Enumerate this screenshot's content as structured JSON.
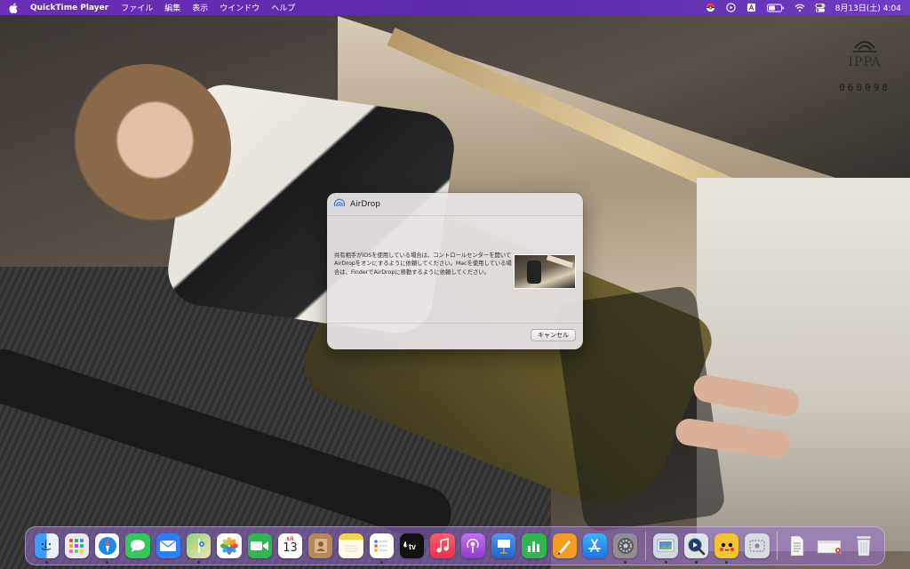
{
  "menubar": {
    "app_name": "QuickTime Player",
    "items": [
      "ファイル",
      "編集",
      "表示",
      "ウインドウ",
      "ヘルプ"
    ],
    "datetime": "8月13日(土) 4:04",
    "status_icons": [
      "pokeball-icon",
      "play-circle-icon",
      "input-source-icon",
      "battery-icon",
      "wifi-icon",
      "control-center-icon"
    ]
  },
  "watermark": {
    "brand": "IPPA",
    "code": "060098"
  },
  "dialog": {
    "title": "AirDrop",
    "message": "共有相手がiOSを使用している場合は、コントロールセンターを開いてAirDropをオンにするように依頼してください。Macを使用している場合は、FinderでAirDropに移動するように依頼してください。",
    "cancel_label": "キャンセル"
  },
  "dock": {
    "calendar": {
      "month": "8月",
      "day": "13"
    },
    "apps": [
      {
        "name": "finder-icon",
        "color": "#2f8ff0"
      },
      {
        "name": "launchpad-icon",
        "color": "#e8e8ee"
      },
      {
        "name": "safari-icon",
        "color": "#1e88e5"
      },
      {
        "name": "messages-icon",
        "color": "#34c759"
      },
      {
        "name": "mail-icon",
        "color": "#2d7ff9"
      },
      {
        "name": "maps-icon",
        "color": "#6cc46a"
      },
      {
        "name": "photos-icon",
        "color": "#ffffff"
      },
      {
        "name": "facetime-icon",
        "color": "#2fb84f"
      },
      {
        "name": "calendar-icon",
        "color": "#ffffff"
      },
      {
        "name": "contacts-icon",
        "color": "#b58a56"
      },
      {
        "name": "notes-icon",
        "color": "#fff2a8"
      },
      {
        "name": "reminders-icon",
        "color": "#ffffff"
      },
      {
        "name": "tv-icon",
        "color": "#111111"
      },
      {
        "name": "music-icon",
        "color": "#fa3e55"
      },
      {
        "name": "podcasts-icon",
        "color": "#a44be0"
      },
      {
        "name": "keynote-icon",
        "color": "#2f7be0"
      },
      {
        "name": "numbers-icon",
        "color": "#2fb84f"
      },
      {
        "name": "pages-icon",
        "color": "#f59a23"
      },
      {
        "name": "app-store-icon",
        "color": "#1c8cf0"
      },
      {
        "name": "system-preferences-icon",
        "color": "#8e8e93"
      },
      {
        "name": "preview-icon",
        "color": "#cfd9e6"
      },
      {
        "name": "quicktime-icon",
        "color": "#dfe3ea"
      },
      {
        "name": "pokemon-app-icon",
        "color": "#f4c430"
      },
      {
        "name": "screenshot-app-icon",
        "color": "#d7dbe2"
      },
      {
        "name": "document-icon",
        "color": "#f4f4f4"
      },
      {
        "name": "window-stack-icon",
        "color": "#f4f4f4"
      },
      {
        "name": "trash-icon",
        "color": "#dfe3e8"
      }
    ]
  }
}
